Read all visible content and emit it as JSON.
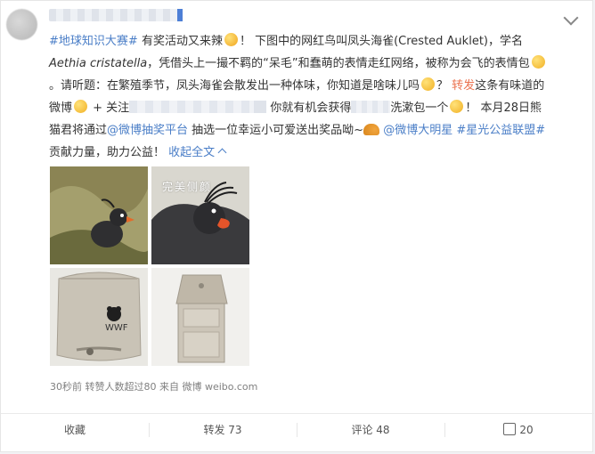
{
  "post": {
    "tags": {
      "topic": "#地球知识大赛#",
      "weibo_lottery": "@微博抽奖平台",
      "weibo_star": "@微博大明星",
      "alliance": "#星光公益联盟#",
      "repost_action": "转发",
      "collapse": "收起全文",
      "collapse_icon": "chevron-up-icon"
    },
    "text": {
      "l1a": "有奖活动又来辣",
      "l1b": "！ 下图中的网红鸟叫凤头海雀(Crested Auklet)，学名",
      "l2a": "Aethia cristatella",
      "l2b": "，凭借头上一撮不羁的“呆毛”和蠢萌的表情走红网络，被称为会飞的表情包",
      "l3a": "。请听题：在繁殖季节，凤头海雀会散发出一种体味，你知道是啥味儿吗",
      "l3b": "？",
      "l3c": "这条有味道的",
      "l4a": "微博",
      "l4b": " + 关注",
      "l4c": " 你就有机会获得",
      "l4d": "洗漱包一个",
      "l4e": "！ 本月28日熊",
      "l5a": "猫君将通过",
      "l5b": " 抽选一位幸运小可爱送出奖品呦~",
      "l6a": "贡献力量，助力公益！",
      "l6b": " "
    },
    "images": [
      {
        "label": ""
      },
      {
        "label": "完美侧颜"
      },
      {
        "label": ""
      },
      {
        "label": ""
      }
    ],
    "meta": "30秒前 转赞人数超过80 来自 微博 weibo.com"
  },
  "actions": {
    "favorite": "收藏",
    "repost": "转发 73",
    "comment": "评论 48",
    "like": "20"
  },
  "colors": {
    "link_blue": "#4a7ec7",
    "accent_orange": "#eb7350"
  }
}
